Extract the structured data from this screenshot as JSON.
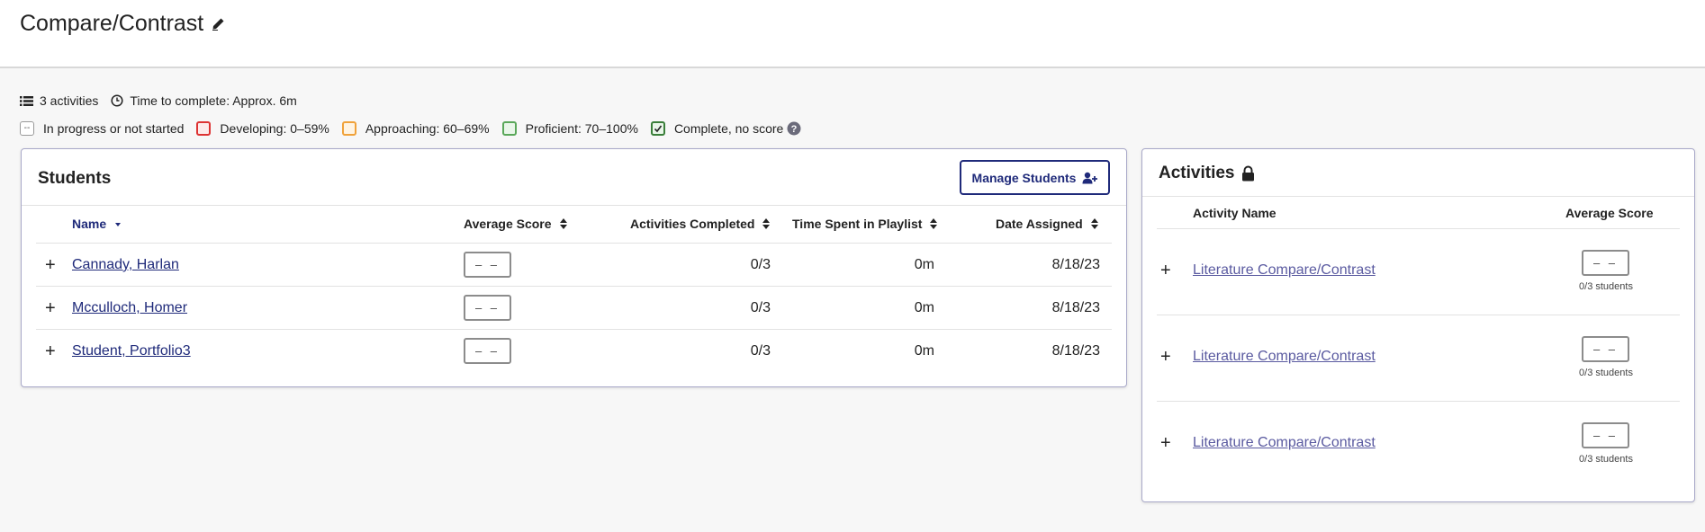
{
  "page": {
    "title": "Compare/Contrast"
  },
  "meta": {
    "activities_count": "3 activities",
    "time_to_complete": "Time to complete: Approx. 6m"
  },
  "legend": {
    "in_progress": {
      "symbol": "--",
      "label": "In progress or not started"
    },
    "developing": {
      "label": "Developing: 0–59%",
      "color": "#d33333"
    },
    "approaching": {
      "label": "Approaching: 60–69%",
      "color": "#f0a23a"
    },
    "proficient": {
      "label": "Proficient: 70–100%",
      "color": "#5aa85a"
    },
    "complete": {
      "label": "Complete, no score",
      "symbol": "✓",
      "color": "#3a7f3a"
    }
  },
  "students": {
    "title": "Students",
    "manage_button": "Manage Students",
    "columns": {
      "name": "Name",
      "average_score": "Average Score",
      "activities_completed": "Activities Completed",
      "time_spent": "Time Spent in Playlist",
      "date_assigned": "Date Assigned"
    },
    "rows": [
      {
        "expand": "+",
        "name": "Cannady, Harlan",
        "score": "– –",
        "completed": "0/3",
        "time": "0m",
        "date": "8/18/23"
      },
      {
        "expand": "+",
        "name": "Mcculloch, Homer",
        "score": "– –",
        "completed": "0/3",
        "time": "0m",
        "date": "8/18/23"
      },
      {
        "expand": "+",
        "name": "Student, Portfolio3",
        "score": "– –",
        "completed": "0/3",
        "time": "0m",
        "date": "8/18/23"
      }
    ]
  },
  "activities": {
    "title": "Activities",
    "columns": {
      "activity_name": "Activity Name",
      "average_score": "Average Score"
    },
    "rows": [
      {
        "expand": "+",
        "name": "Literature Compare/Contrast",
        "score": "– –",
        "students": "0/3 students"
      },
      {
        "expand": "+",
        "name": "Literature Compare/Contrast",
        "score": "– –",
        "students": "0/3 students"
      },
      {
        "expand": "+",
        "name": "Literature Compare/Contrast",
        "score": "– –",
        "students": "0/3 students"
      }
    ]
  },
  "colors": {
    "accent": "#1f2a7a",
    "link_activity": "#5a5aa0"
  }
}
